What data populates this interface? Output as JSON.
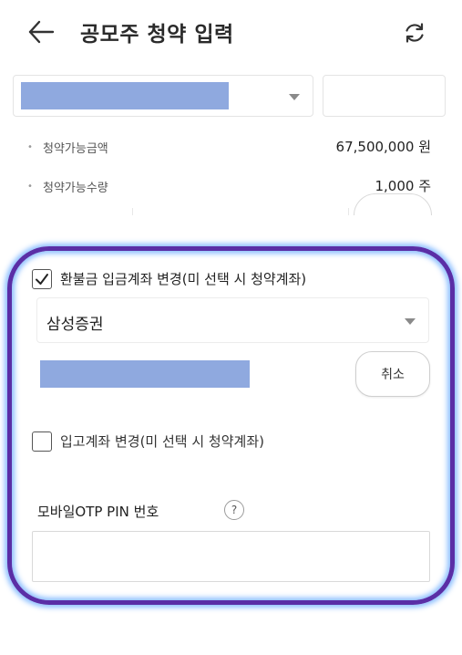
{
  "header": {
    "title": "공모주 청약 입력"
  },
  "info": {
    "rows": [
      {
        "label": "청약가능금액",
        "value": "67,500,000 원"
      },
      {
        "label": "청약가능수량",
        "value": "1,000 주"
      }
    ]
  },
  "refund": {
    "checkbox_label": "환불금 입금계좌 변경(미 선택 시 청약계좌)",
    "checked": true,
    "bank_value": "삼성증권",
    "cancel_label": "취소"
  },
  "deposit": {
    "checkbox_label": "입고계좌 변경(미 선택 시 청약계좌)",
    "checked": false
  },
  "otp": {
    "label": "모바일OTP PIN 번호",
    "help_glyph": "?"
  },
  "colors": {
    "highlight": "#5a2ea6",
    "masked": "#8fa9df"
  }
}
